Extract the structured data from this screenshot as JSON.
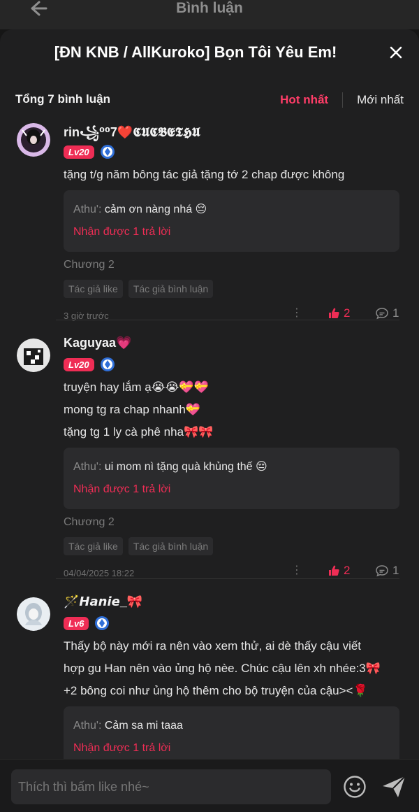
{
  "topbar": {
    "title": "Bình luận"
  },
  "sheet": {
    "title": "[ĐN KNB / AllKuroko] Bọn Tôi Yêu Em!"
  },
  "comments_header": {
    "count_label": "Tổng 7 bình luận",
    "sort_hot": "Hot nhất",
    "sort_new": "Mới nhất"
  },
  "comments": [
    {
      "username": "rin꧁⁰⁰7❤️𝕮𝖀𝕮𝕭𝕰𝕿𝕳𝖀",
      "level": "Lv20",
      "lines": [
        "tặng t/g năm bông tác giả tặng tớ 2 chap được không"
      ],
      "reply_author": "Athu':",
      "reply_text": " cảm ơn nàng nhá 😔",
      "reply_more": "Nhận được 1 trả lời",
      "chapter": "Chương 2",
      "tag_like": "Tác giả like",
      "tag_comment": "Tác giả bình luận",
      "time": "3 giờ trước",
      "likes": "2",
      "replies": "1"
    },
    {
      "username": "Kaguyaa💗",
      "level": "Lv20",
      "lines": [
        "truyện hay lắm ạ😭😭💝💝",
        "mong tg ra chap nhanh💝",
        "tặng tg 1 ly cà phê nha🎀🎀"
      ],
      "reply_author": "Athu':",
      "reply_text": " ui mom nì tặng quà khủng thế 😔",
      "reply_more": "Nhận được 1 trả lời",
      "chapter": "Chương 2",
      "tag_like": "Tác giả like",
      "tag_comment": "Tác giả bình luận",
      "time": "04/04/2025 18:22",
      "likes": "2",
      "replies": "1"
    },
    {
      "username": "🪄𝙃𝙖𝙣𝙞𝙚_🎀",
      "level": "Lv6",
      "lines": [
        "Thấy bộ này mới ra nên vào xem thử, ai dè thấy cậu viết",
        "hợp gu Han nên vào ủng hộ nèe. Chúc cậu lên xh nhée:3🎀",
        "+2 bông coi như ủng hộ thêm cho bộ truyện của cậu><🌹"
      ],
      "reply_author": "Athu':",
      "reply_text": " Cảm sa mi taaa",
      "reply_more": "Nhận được 1 trả lời"
    }
  ],
  "composer": {
    "placeholder": "Thích thì bấm like nhé~"
  },
  "colors": {
    "accent": "#ef2d55",
    "background": "#1f1f20",
    "card": "#2b2b2d",
    "badge_blue": "#2f6fd8"
  }
}
